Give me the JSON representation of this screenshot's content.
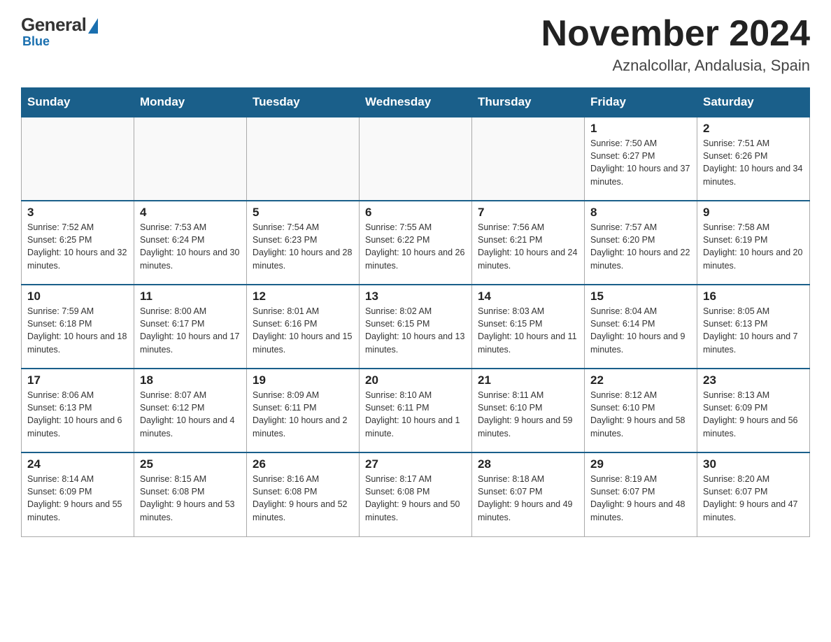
{
  "header": {
    "logo": {
      "general": "General",
      "blue": "Blue"
    },
    "title": "November 2024",
    "location": "Aznalcollar, Andalusia, Spain"
  },
  "weekdays": [
    "Sunday",
    "Monday",
    "Tuesday",
    "Wednesday",
    "Thursday",
    "Friday",
    "Saturday"
  ],
  "weeks": [
    [
      {
        "day": "",
        "sunrise": "",
        "sunset": "",
        "daylight": ""
      },
      {
        "day": "",
        "sunrise": "",
        "sunset": "",
        "daylight": ""
      },
      {
        "day": "",
        "sunrise": "",
        "sunset": "",
        "daylight": ""
      },
      {
        "day": "",
        "sunrise": "",
        "sunset": "",
        "daylight": ""
      },
      {
        "day": "",
        "sunrise": "",
        "sunset": "",
        "daylight": ""
      },
      {
        "day": "1",
        "sunrise": "Sunrise: 7:50 AM",
        "sunset": "Sunset: 6:27 PM",
        "daylight": "Daylight: 10 hours and 37 minutes."
      },
      {
        "day": "2",
        "sunrise": "Sunrise: 7:51 AM",
        "sunset": "Sunset: 6:26 PM",
        "daylight": "Daylight: 10 hours and 34 minutes."
      }
    ],
    [
      {
        "day": "3",
        "sunrise": "Sunrise: 7:52 AM",
        "sunset": "Sunset: 6:25 PM",
        "daylight": "Daylight: 10 hours and 32 minutes."
      },
      {
        "day": "4",
        "sunrise": "Sunrise: 7:53 AM",
        "sunset": "Sunset: 6:24 PM",
        "daylight": "Daylight: 10 hours and 30 minutes."
      },
      {
        "day": "5",
        "sunrise": "Sunrise: 7:54 AM",
        "sunset": "Sunset: 6:23 PM",
        "daylight": "Daylight: 10 hours and 28 minutes."
      },
      {
        "day": "6",
        "sunrise": "Sunrise: 7:55 AM",
        "sunset": "Sunset: 6:22 PM",
        "daylight": "Daylight: 10 hours and 26 minutes."
      },
      {
        "day": "7",
        "sunrise": "Sunrise: 7:56 AM",
        "sunset": "Sunset: 6:21 PM",
        "daylight": "Daylight: 10 hours and 24 minutes."
      },
      {
        "day": "8",
        "sunrise": "Sunrise: 7:57 AM",
        "sunset": "Sunset: 6:20 PM",
        "daylight": "Daylight: 10 hours and 22 minutes."
      },
      {
        "day": "9",
        "sunrise": "Sunrise: 7:58 AM",
        "sunset": "Sunset: 6:19 PM",
        "daylight": "Daylight: 10 hours and 20 minutes."
      }
    ],
    [
      {
        "day": "10",
        "sunrise": "Sunrise: 7:59 AM",
        "sunset": "Sunset: 6:18 PM",
        "daylight": "Daylight: 10 hours and 18 minutes."
      },
      {
        "day": "11",
        "sunrise": "Sunrise: 8:00 AM",
        "sunset": "Sunset: 6:17 PM",
        "daylight": "Daylight: 10 hours and 17 minutes."
      },
      {
        "day": "12",
        "sunrise": "Sunrise: 8:01 AM",
        "sunset": "Sunset: 6:16 PM",
        "daylight": "Daylight: 10 hours and 15 minutes."
      },
      {
        "day": "13",
        "sunrise": "Sunrise: 8:02 AM",
        "sunset": "Sunset: 6:15 PM",
        "daylight": "Daylight: 10 hours and 13 minutes."
      },
      {
        "day": "14",
        "sunrise": "Sunrise: 8:03 AM",
        "sunset": "Sunset: 6:15 PM",
        "daylight": "Daylight: 10 hours and 11 minutes."
      },
      {
        "day": "15",
        "sunrise": "Sunrise: 8:04 AM",
        "sunset": "Sunset: 6:14 PM",
        "daylight": "Daylight: 10 hours and 9 minutes."
      },
      {
        "day": "16",
        "sunrise": "Sunrise: 8:05 AM",
        "sunset": "Sunset: 6:13 PM",
        "daylight": "Daylight: 10 hours and 7 minutes."
      }
    ],
    [
      {
        "day": "17",
        "sunrise": "Sunrise: 8:06 AM",
        "sunset": "Sunset: 6:13 PM",
        "daylight": "Daylight: 10 hours and 6 minutes."
      },
      {
        "day": "18",
        "sunrise": "Sunrise: 8:07 AM",
        "sunset": "Sunset: 6:12 PM",
        "daylight": "Daylight: 10 hours and 4 minutes."
      },
      {
        "day": "19",
        "sunrise": "Sunrise: 8:09 AM",
        "sunset": "Sunset: 6:11 PM",
        "daylight": "Daylight: 10 hours and 2 minutes."
      },
      {
        "day": "20",
        "sunrise": "Sunrise: 8:10 AM",
        "sunset": "Sunset: 6:11 PM",
        "daylight": "Daylight: 10 hours and 1 minute."
      },
      {
        "day": "21",
        "sunrise": "Sunrise: 8:11 AM",
        "sunset": "Sunset: 6:10 PM",
        "daylight": "Daylight: 9 hours and 59 minutes."
      },
      {
        "day": "22",
        "sunrise": "Sunrise: 8:12 AM",
        "sunset": "Sunset: 6:10 PM",
        "daylight": "Daylight: 9 hours and 58 minutes."
      },
      {
        "day": "23",
        "sunrise": "Sunrise: 8:13 AM",
        "sunset": "Sunset: 6:09 PM",
        "daylight": "Daylight: 9 hours and 56 minutes."
      }
    ],
    [
      {
        "day": "24",
        "sunrise": "Sunrise: 8:14 AM",
        "sunset": "Sunset: 6:09 PM",
        "daylight": "Daylight: 9 hours and 55 minutes."
      },
      {
        "day": "25",
        "sunrise": "Sunrise: 8:15 AM",
        "sunset": "Sunset: 6:08 PM",
        "daylight": "Daylight: 9 hours and 53 minutes."
      },
      {
        "day": "26",
        "sunrise": "Sunrise: 8:16 AM",
        "sunset": "Sunset: 6:08 PM",
        "daylight": "Daylight: 9 hours and 52 minutes."
      },
      {
        "day": "27",
        "sunrise": "Sunrise: 8:17 AM",
        "sunset": "Sunset: 6:08 PM",
        "daylight": "Daylight: 9 hours and 50 minutes."
      },
      {
        "day": "28",
        "sunrise": "Sunrise: 8:18 AM",
        "sunset": "Sunset: 6:07 PM",
        "daylight": "Daylight: 9 hours and 49 minutes."
      },
      {
        "day": "29",
        "sunrise": "Sunrise: 8:19 AM",
        "sunset": "Sunset: 6:07 PM",
        "daylight": "Daylight: 9 hours and 48 minutes."
      },
      {
        "day": "30",
        "sunrise": "Sunrise: 8:20 AM",
        "sunset": "Sunset: 6:07 PM",
        "daylight": "Daylight: 9 hours and 47 minutes."
      }
    ]
  ]
}
